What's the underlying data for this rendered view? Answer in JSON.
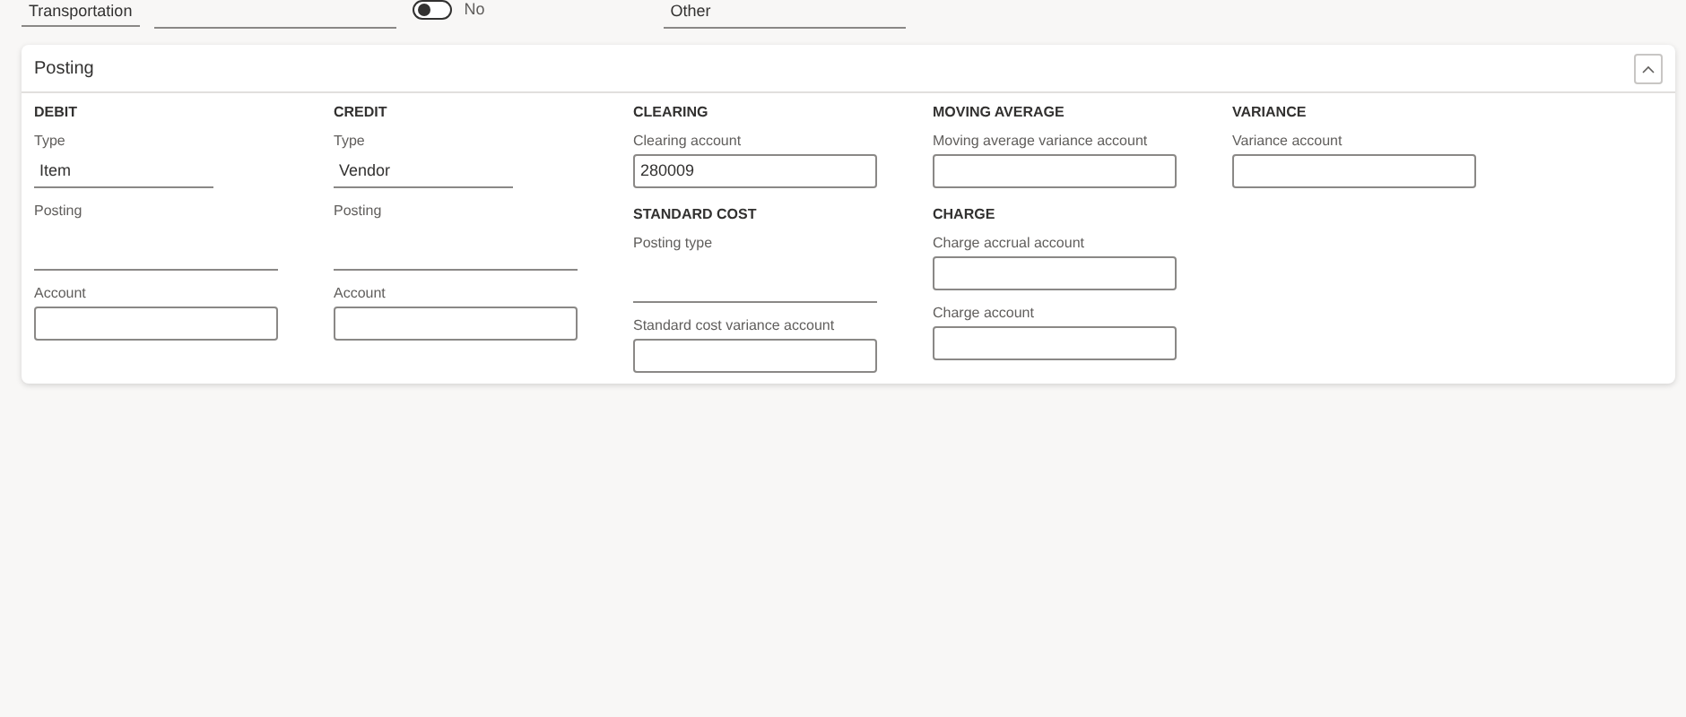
{
  "top_fields": [
    {
      "kind": "line",
      "value": "Transportation"
    },
    {
      "kind": "line-wide"
    },
    {
      "kind": "toggle",
      "on": false,
      "label": "No"
    },
    {
      "kind": "line-wide",
      "value": "Other"
    }
  ],
  "card": {
    "title": "Posting",
    "expanded": true,
    "columns": [
      {
        "groups": [
          {
            "title": "DEBIT",
            "fields": [
              {
                "label": "Type",
                "kind": "select",
                "value": "Item"
              },
              {
                "label": "Posting",
                "kind": "line"
              },
              {
                "label": "Account",
                "kind": "box"
              }
            ]
          }
        ]
      },
      {
        "groups": [
          {
            "title": "CREDIT",
            "fields": [
              {
                "label": "Type",
                "kind": "select",
                "value": "Vendor"
              },
              {
                "label": "Posting",
                "kind": "line"
              },
              {
                "label": "Account",
                "kind": "box"
              }
            ]
          }
        ]
      },
      {
        "groups": [
          {
            "title": "CLEARING",
            "fields": [
              {
                "label": "Clearing account",
                "kind": "box",
                "value": "280009"
              }
            ]
          },
          {
            "title": "STANDARD COST",
            "fields": [
              {
                "label": "Posting type",
                "kind": "line"
              },
              {
                "label": "Standard cost variance account",
                "kind": "box"
              }
            ]
          }
        ]
      },
      {
        "groups": [
          {
            "title": "MOVING AVERAGE",
            "fields": [
              {
                "label": "Moving average variance account",
                "kind": "box"
              }
            ]
          },
          {
            "title": "CHARGE",
            "fields": [
              {
                "label": "Charge accrual account",
                "kind": "box"
              },
              {
                "label": "Charge account",
                "kind": "box"
              }
            ]
          }
        ]
      },
      {
        "groups": [
          {
            "title": "VARIANCE",
            "fields": [
              {
                "label": "Variance account",
                "kind": "box"
              }
            ]
          }
        ]
      }
    ]
  }
}
